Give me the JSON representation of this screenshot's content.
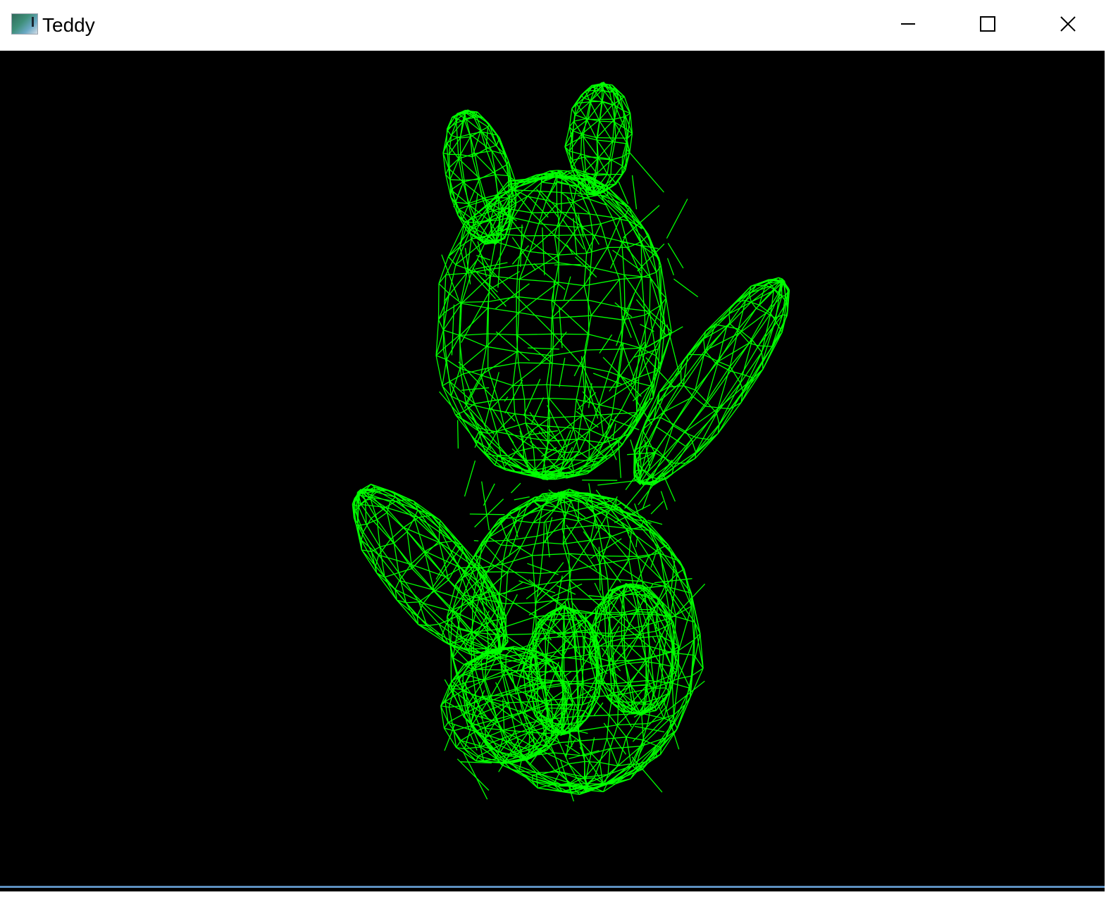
{
  "window": {
    "title": "Teddy",
    "icon": "app-icon",
    "background": "#000000",
    "border_color": "#5d8fbf"
  },
  "caption_buttons": {
    "minimize_icon": "minimize-icon",
    "maximize_icon": "maximize-icon",
    "close_icon": "close-icon"
  },
  "viewport": {
    "content": "wireframe-teddy-bear-model",
    "wire_color": "#00ff00"
  }
}
